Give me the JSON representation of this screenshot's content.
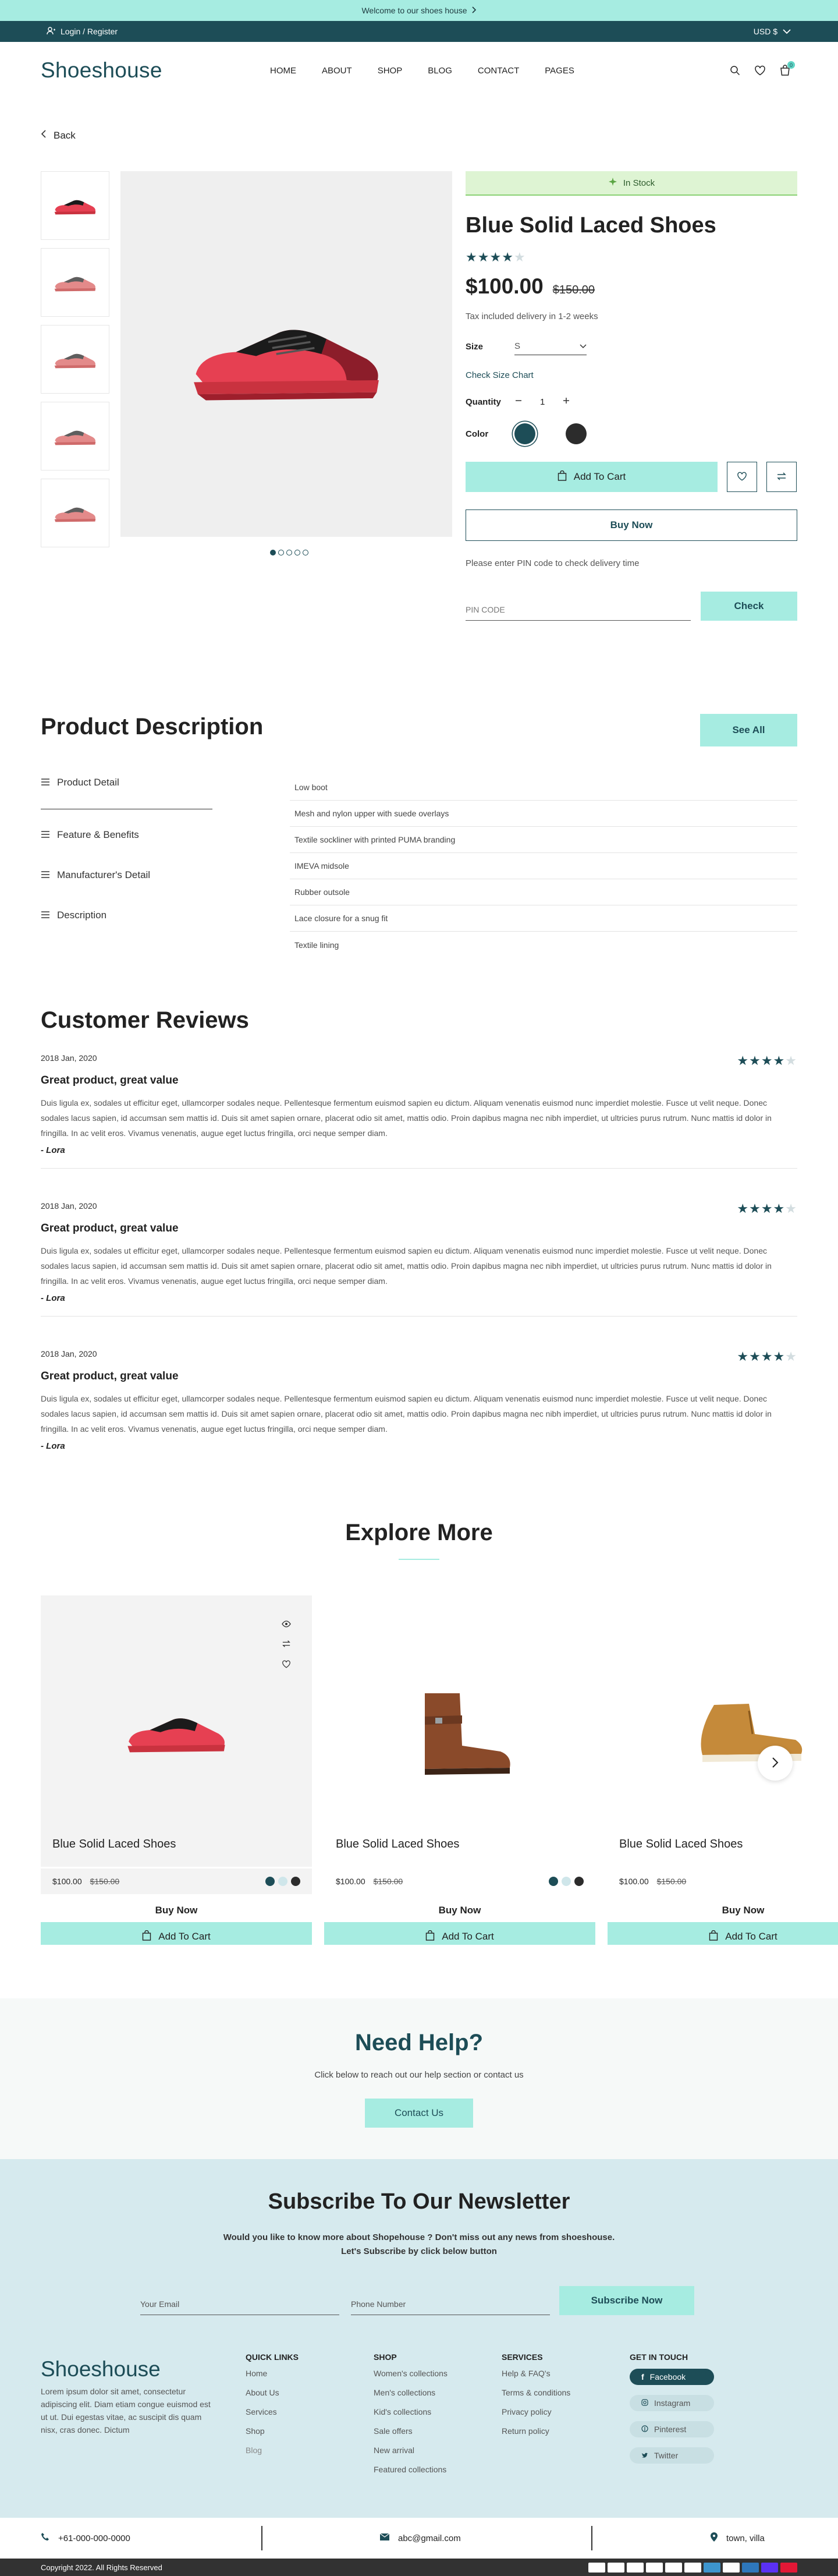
{
  "announce": {
    "text": "Welcome to our shoes house"
  },
  "topbar": {
    "login": "Login / Register",
    "currency": "USD $"
  },
  "brand": {
    "logo": "Shoeshouse"
  },
  "menu": [
    "HOME",
    "ABOUT",
    "SHOP",
    "BLOG",
    "CONTACT",
    "PAGES"
  ],
  "cart_count": "0",
  "back_label": "Back",
  "product": {
    "stock": "In Stock",
    "title": "Blue Solid Laced Shoes",
    "rating": 4,
    "price": "$100.00",
    "old_price": "$150.00",
    "tax": "Tax included delivery in 1-2 weeks",
    "size_label": "Size",
    "size_value": "S",
    "size_chart": "Check Size Chart",
    "qty_label": "Quantity",
    "qty_value": "1",
    "color_label": "Color",
    "colors": [
      "#1d4d57",
      "#2c2c2c"
    ],
    "add_to_cart": "Add To Cart",
    "buy_now": "Buy Now",
    "pin_note": "Please enter PIN code to check delivery time",
    "pin_placeholder": "PIN CODE",
    "check": "Check"
  },
  "description": {
    "heading": "Product Description",
    "see_all": "See All",
    "tabs": [
      "Product Detail",
      "Feature & Benefits",
      "Manufacturer's Detail",
      "Description"
    ],
    "details": [
      "Low boot",
      "Mesh and nylon upper with suede overlays",
      "Textile sockliner with printed PUMA branding",
      "IMEVA midsole",
      "Rubber outsole",
      "Lace closure for a snug fit",
      "Textile lining"
    ]
  },
  "reviews": {
    "heading": "Customer Reviews",
    "items": [
      {
        "date": "2018 Jan, 2020",
        "title": "Great product, great value",
        "rating": 4,
        "body": "Duis ligula ex, sodales ut efficitur eget, ullamcorper sodales neque. Pellentesque fermentum euismod sapien eu dictum. Aliquam venenatis euismod nunc imperdiet molestie. Fusce ut velit neque. Donec sodales lacus sapien, id accumsan sem mattis id. Duis sit amet sapien ornare, placerat odio sit amet, mattis odio. Proin dapibus magna nec nibh imperdiet, ut ultricies purus rutrum. Nunc mattis id dolor in fringilla. In ac velit eros. Vivamus venenatis, augue eget luctus fringilla, orci neque semper diam.",
        "author": "- Lora"
      },
      {
        "date": "2018 Jan, 2020",
        "title": "Great product, great value",
        "rating": 4,
        "body": "Duis ligula ex, sodales ut efficitur eget, ullamcorper sodales neque. Pellentesque fermentum euismod sapien eu dictum. Aliquam venenatis euismod nunc imperdiet molestie. Fusce ut velit neque. Donec sodales lacus sapien, id accumsan sem mattis id. Duis sit amet sapien ornare, placerat odio sit amet, mattis odio. Proin dapibus magna nec nibh imperdiet, ut ultricies purus rutrum. Nunc mattis id dolor in fringilla. In ac velit eros. Vivamus venenatis, augue eget luctus fringilla, orci neque semper diam.",
        "author": "- Lora"
      },
      {
        "date": "2018 Jan, 2020",
        "title": "Great product, great value",
        "rating": 4,
        "body": "Duis ligula ex, sodales ut efficitur eget, ullamcorper sodales neque. Pellentesque fermentum euismod sapien eu dictum. Aliquam venenatis euismod nunc imperdiet molestie. Fusce ut velit neque. Donec sodales lacus sapien, id accumsan sem mattis id. Duis sit amet sapien ornare, placerat odio sit amet, mattis odio. Proin dapibus magna nec nibh imperdiet, ut ultricies purus rutrum. Nunc mattis id dolor in fringilla. In ac velit eros. Vivamus venenatis, augue eget luctus fringilla, orci neque semper diam.",
        "author": "- Lora"
      }
    ]
  },
  "explore": {
    "heading": "Explore More",
    "cards": [
      {
        "name": "Blue Solid Laced Shoes",
        "price": "$100.00",
        "old": "$150.00",
        "buy": "Buy Now",
        "cart": "Add To Cart"
      },
      {
        "name": "Blue Solid Laced Shoes",
        "price": "$100.00",
        "old": "$150.00",
        "buy": "Buy Now",
        "cart": "Add To Cart"
      },
      {
        "name": "Blue Solid Laced Shoes",
        "price": "$100.00",
        "old": "$150.00",
        "buy": "Buy Now",
        "cart": "Add To Cart"
      }
    ]
  },
  "help": {
    "heading": "Need Help?",
    "text": "Click below to reach out our help section or contact us",
    "button": "Contact Us"
  },
  "newsletter": {
    "heading": "Subscribe To Our Newsletter",
    "line1": "Would you like to know more about Shopehouse ? Don't miss out any news from shoeshouse.",
    "line2": "Let's Subscribe by click below button",
    "email_placeholder": "Your Email",
    "phone_placeholder": "Phone Number",
    "button": "Subscribe Now"
  },
  "footer": {
    "logo": "Shoeshouse",
    "about": "Lorem ipsum dolor sit amet, consectetur adipiscing elit. Diam etiam congue euismod est ut ut. Dui egestas vitae, ac suscipit dis quam nisx, cras donec. Dictum",
    "quick_title": "QUICK LINKS",
    "quick": [
      "Home",
      "About  Us",
      "Services",
      "Shop",
      "Blog"
    ],
    "shop_title": "SHOP",
    "shop": [
      "Women's collections",
      "Men's collections",
      "Kid's collections",
      "Sale offers",
      "New arrival",
      "Featured collections"
    ],
    "services_title": "SERVICES",
    "services": [
      "Help & FAQ's",
      "Terms & conditions",
      "Privacy policy",
      "Return policy"
    ],
    "touch_title": "GET IN TOUCH",
    "social": [
      "Facebook",
      "Instagram",
      "Pinterest",
      "Twitter"
    ]
  },
  "contact": {
    "phone": "+61-000-000-0000",
    "email": "abc@gmail.com",
    "address": "town, villa"
  },
  "copyright": "Copyright 2022. All Rights Reserved"
}
